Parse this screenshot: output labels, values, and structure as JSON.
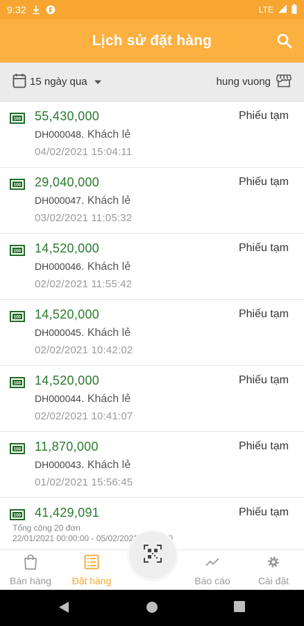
{
  "status_bar": {
    "time": "9:32",
    "network": "LTE"
  },
  "header": {
    "title": "Lịch sử đặt hàng"
  },
  "filter": {
    "date_range": "15 ngày qua",
    "store": "hung vuong"
  },
  "orders": [
    {
      "amount": "55,430,000",
      "code": "DH000048",
      "customer": ". Khách lẻ",
      "datetime": "04/02/2021 15:04:11",
      "status": "Phiếu tạm"
    },
    {
      "amount": "29,040,000",
      "code": "DH000047",
      "customer": ". Khách lẻ",
      "datetime": "03/02/2021 11:05:32",
      "status": "Phiếu tạm"
    },
    {
      "amount": "14,520,000",
      "code": "DH000046",
      "customer": ". Khách lẻ",
      "datetime": "02/02/2021 11:55:42",
      "status": "Phiếu tạm"
    },
    {
      "amount": "14,520,000",
      "code": "DH000045",
      "customer": ". Khách lẻ",
      "datetime": "02/02/2021 10:42:02",
      "status": "Phiếu tạm"
    },
    {
      "amount": "14,520,000",
      "code": "DH000044",
      "customer": ". Khách lẻ",
      "datetime": "02/02/2021 10:41:07",
      "status": "Phiếu tạm"
    },
    {
      "amount": "11,870,000",
      "code": "DH000043",
      "customer": ". Khách lẻ",
      "datetime": "01/02/2021 15:56:45",
      "status": "Phiếu tạm"
    },
    {
      "amount": "41,429,091",
      "code": "",
      "customer": "",
      "datetime": "",
      "status": "Phiếu tạm"
    }
  ],
  "summary": {
    "total": "Tổng cộng 20 đơn",
    "range": "22/01/2021 00:00:00 - 05/02/2021 23:59:00"
  },
  "bottom_nav": {
    "sell": "Bán hàng",
    "orders": "Đặt hàng",
    "reports": "Báo cáo",
    "settings": "Cài đặt"
  },
  "colors": {
    "brand": "#fbb040",
    "amount": "#2a7a2f",
    "active_tab": "#f6a631"
  },
  "icons": {
    "search": "search-icon",
    "calendar": "calendar-icon",
    "dropdown": "caret-down-icon",
    "store": "store-icon",
    "money": "money-icon",
    "qr": "qr-scan-icon"
  }
}
